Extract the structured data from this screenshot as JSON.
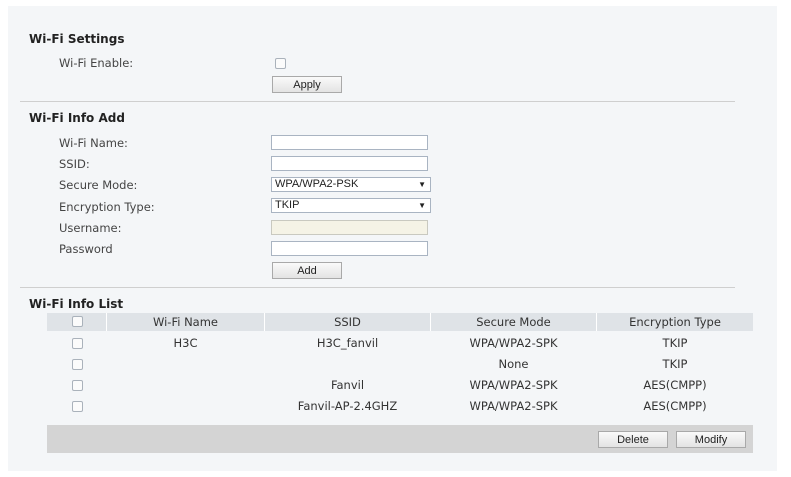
{
  "wifi_settings": {
    "title": "Wi-Fi Settings",
    "enable_label": "Wi-Fi Enable:",
    "apply_label": "Apply"
  },
  "wifi_info_add": {
    "title": "Wi-Fi Info Add",
    "name_label": "Wi-Fi Name:",
    "ssid_label": "SSID:",
    "secure_mode_label": "Secure Mode:",
    "secure_mode_value": "WPA/WPA2-PSK",
    "encryption_label": "Encryption Type:",
    "encryption_value": "TKIP",
    "username_label": "Username:",
    "password_label": "Password",
    "add_label": "Add"
  },
  "wifi_info_list": {
    "title": "Wi-Fi Info List",
    "columns": [
      "Wi-Fi Name",
      "SSID",
      "Secure Mode",
      "Encryption Type"
    ],
    "rows": [
      {
        "name": "H3C",
        "ssid": "H3C_fanvil",
        "secure_mode": "WPA/WPA2-SPK",
        "encryption": "TKIP"
      },
      {
        "name": "",
        "ssid": "",
        "secure_mode": "None",
        "encryption": "TKIP"
      },
      {
        "name": "",
        "ssid": "Fanvil",
        "secure_mode": "WPA/WPA2-SPK",
        "encryption": "AES(CMPP)"
      },
      {
        "name": "",
        "ssid": "Fanvil-AP-2.4GHZ",
        "secure_mode": "WPA/WPA2-SPK",
        "encryption": "AES(CMPP)"
      }
    ],
    "delete_label": "Delete",
    "modify_label": "Modify"
  },
  "icons": {
    "dropdown": "chevron-down-icon",
    "checkbox": "checkbox-icon"
  }
}
